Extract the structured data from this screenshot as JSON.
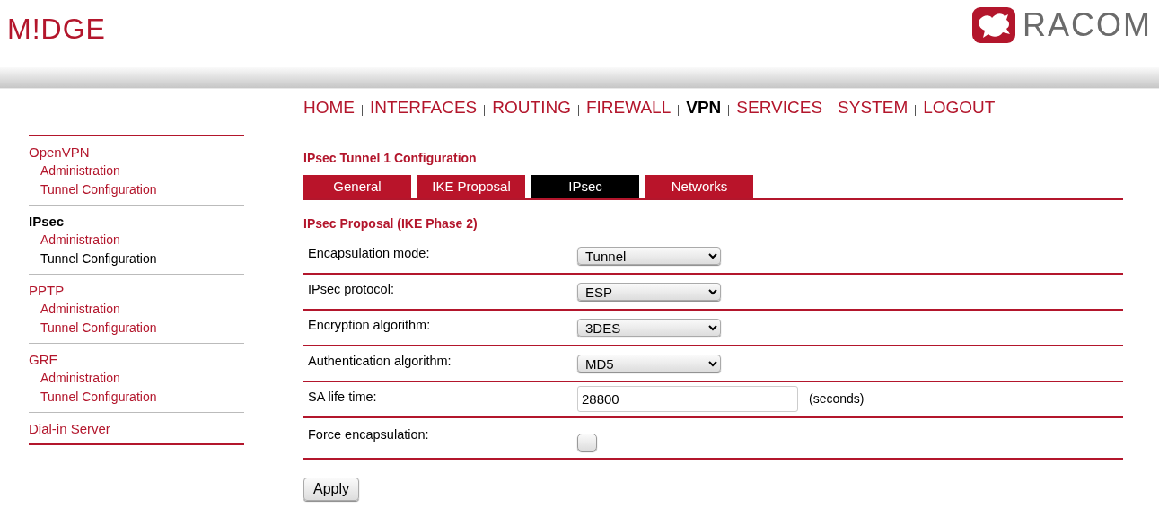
{
  "header": {
    "logo_left": "M!DGE",
    "logo_right": "RACOM"
  },
  "nav": [
    {
      "label": "HOME",
      "selected": false
    },
    {
      "label": "INTERFACES",
      "selected": false
    },
    {
      "label": "ROUTING",
      "selected": false
    },
    {
      "label": "FIREWALL",
      "selected": false
    },
    {
      "label": "VPN",
      "selected": true
    },
    {
      "label": "SERVICES",
      "selected": false
    },
    {
      "label": "SYSTEM",
      "selected": false
    },
    {
      "label": "LOGOUT",
      "selected": false
    }
  ],
  "sidebar": [
    {
      "label": "OpenVPN",
      "selected": false,
      "children": [
        {
          "label": "Administration",
          "selected": false
        },
        {
          "label": "Tunnel Configuration",
          "selected": false
        }
      ]
    },
    {
      "label": "IPsec",
      "selected": true,
      "children": [
        {
          "label": "Administration",
          "selected": false
        },
        {
          "label": "Tunnel Configuration",
          "selected": true
        }
      ]
    },
    {
      "label": "PPTP",
      "selected": false,
      "children": [
        {
          "label": "Administration",
          "selected": false
        },
        {
          "label": "Tunnel Configuration",
          "selected": false
        }
      ]
    },
    {
      "label": "GRE",
      "selected": false,
      "children": [
        {
          "label": "Administration",
          "selected": false
        },
        {
          "label": "Tunnel Configuration",
          "selected": false
        }
      ]
    },
    {
      "label": "Dial-in Server",
      "selected": false
    }
  ],
  "page_title": "IPsec Tunnel 1 Configuration",
  "tabs": [
    {
      "label": "General",
      "selected": false
    },
    {
      "label": "IKE Proposal",
      "selected": false
    },
    {
      "label": "IPsec",
      "selected": true
    },
    {
      "label": "Networks",
      "selected": false
    }
  ],
  "section_title": "IPsec Proposal (IKE Phase 2)",
  "rows": [
    {
      "kind": "select",
      "label": "Encapsulation mode:",
      "value": "Tunnel"
    },
    {
      "kind": "select",
      "label": "IPsec protocol:",
      "value": "ESP"
    },
    {
      "kind": "select",
      "label": "Encryption algorithm:",
      "value": "3DES"
    },
    {
      "kind": "select",
      "label": "Authentication algorithm:",
      "value": "MD5"
    },
    {
      "kind": "text",
      "label": "SA life time:",
      "value": "28800",
      "unit": "(seconds)"
    },
    {
      "kind": "checkbox",
      "label": "Force encapsulation:",
      "checked": false
    }
  ],
  "apply_button": "Apply"
}
